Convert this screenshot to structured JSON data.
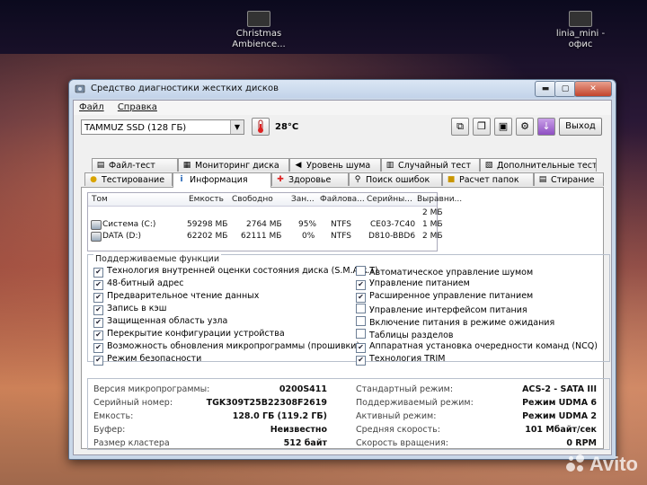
{
  "desktop": {
    "icons": [
      {
        "label_line1": "Christmas",
        "label_line2": "Ambience..."
      },
      {
        "label_line1": "linia_mini -",
        "label_line2": "офис"
      }
    ],
    "watermark": "Avito"
  },
  "window": {
    "title": "Средство диагностики жестких дисков",
    "controls": {
      "minimize": "▬",
      "maximize": "▢",
      "close": "✕"
    }
  },
  "menu": [
    "Файл",
    "Справка"
  ],
  "toolbar": {
    "disk_selected": "TAMMUZ SSD (128 ГБ)",
    "temperature": "28°C",
    "exit_label": "Выход"
  },
  "tabs_row1": [
    {
      "label": "Файл-тест",
      "icon": "file-icon"
    },
    {
      "label": "Мониторинг диска",
      "icon": "monitor-icon"
    },
    {
      "label": "Уровень шума",
      "icon": "speaker-icon"
    },
    {
      "label": "Случайный тест",
      "icon": "random-icon"
    },
    {
      "label": "Дополнительные тесты",
      "icon": "tools-icon"
    }
  ],
  "tabs_row2": [
    {
      "label": "Тестирование",
      "icon": "bulb-icon"
    },
    {
      "label": "Информация",
      "icon": "info-icon",
      "active": true
    },
    {
      "label": "Здоровье",
      "icon": "health-icon"
    },
    {
      "label": "Поиск ошибок",
      "icon": "search-icon"
    },
    {
      "label": "Расчет папок",
      "icon": "folder-icon"
    },
    {
      "label": "Стирание",
      "icon": "erase-icon"
    }
  ],
  "volumes": {
    "columns": [
      "Том",
      "Емкость",
      "Свободно",
      "Зан...",
      "Файлова...",
      "Серийны...",
      "Выравни..."
    ],
    "rows": [
      {
        "name": "",
        "capacity": "",
        "free": "",
        "used": "",
        "fs": "",
        "serial": "",
        "align": "2 МБ"
      },
      {
        "name": "Система (C:)",
        "capacity": "59298 МБ",
        "free": "2764 МБ",
        "used": "95%",
        "fs": "NTFS",
        "serial": "CE03-7C40",
        "align": "1 МБ"
      },
      {
        "name": "DATA (D:)",
        "capacity": "62202 МБ",
        "free": "62111 МБ",
        "used": "0%",
        "fs": "NTFS",
        "serial": "D810-BBD6",
        "align": "2 МБ"
      }
    ]
  },
  "features": {
    "title": "Поддерживаемые функции",
    "left": [
      {
        "label": "Технология внутренней оценки состояния диска (S.M.A.R.T)",
        "checked": true
      },
      {
        "label": "48-битный адрес",
        "checked": true
      },
      {
        "label": "Предварительное чтение данных",
        "checked": true
      },
      {
        "label": "Запись в кэш",
        "checked": true
      },
      {
        "label": "Защищенная область узла",
        "checked": true
      },
      {
        "label": "Перекрытие конфигурации устройства",
        "checked": true
      },
      {
        "label": "Возможность обновления микропрограммы (прошивки)",
        "checked": true
      },
      {
        "label": "Режим безопасности",
        "checked": true
      }
    ],
    "right": [
      {
        "label": "Автоматическое управление шумом",
        "checked": false
      },
      {
        "label": "Управление питанием",
        "checked": true
      },
      {
        "label": "Расширенное управление питанием",
        "checked": true
      },
      {
        "label": "Управление интерфейсом питания",
        "checked": false
      },
      {
        "label": "Включение питания в режиме ожидания",
        "checked": false
      },
      {
        "label": "Таблицы разделов",
        "checked": false
      },
      {
        "label": "Аппаратная установка очередности команд (NCQ)",
        "checked": true
      },
      {
        "label": "Технология TRIM",
        "checked": true
      }
    ]
  },
  "info": {
    "left": [
      {
        "label": "Версия микропрограммы:",
        "value": "0200S411"
      },
      {
        "label": "Серийный номер:",
        "value": "TGK309T25B22308F2619"
      },
      {
        "label": "Емкость:",
        "value": "128.0 ГБ (119.2 ГБ)"
      },
      {
        "label": "Буфер:",
        "value": "Неизвестно"
      },
      {
        "label": "Размер кластера",
        "value": "512 байт"
      }
    ],
    "right": [
      {
        "label": "Стандартный режим:",
        "value": "ACS-2 - SATA III"
      },
      {
        "label": "Поддерживаемый режим:",
        "value": "Режим UDMA 6"
      },
      {
        "label": "Активный режим:",
        "value": "Режим UDMA 2"
      },
      {
        "label": "Средняя скорость:",
        "value": "101 Мбайт/сек"
      },
      {
        "label": "Скорость вращения:",
        "value": "0 RPM"
      }
    ]
  }
}
